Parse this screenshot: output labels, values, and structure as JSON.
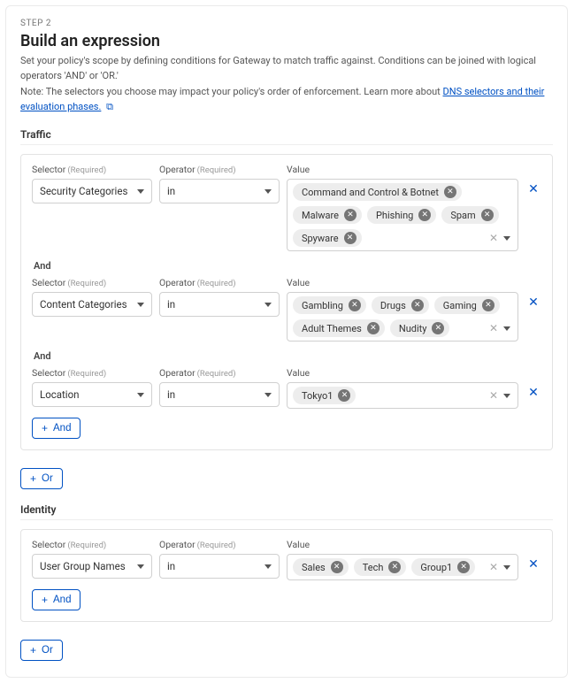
{
  "step_label": "STEP 2",
  "title": "Build an expression",
  "description_line1": "Set your policy's scope by defining conditions for Gateway to match traffic against. Conditions can be joined with logical operators 'AND' or 'OR.'",
  "description_line2_prefix": "Note: The selectors you choose may impact your policy's order of enforcement. Learn more about ",
  "description_link": "DNS selectors and their evaluation phases.",
  "labels": {
    "selector": "Selector",
    "operator": "Operator",
    "value": "Value",
    "required": "(Required)",
    "and": "And",
    "or": "Or",
    "add_and": "And",
    "add_or": "Or"
  },
  "sections": {
    "traffic": {
      "heading": "Traffic"
    },
    "identity": {
      "heading": "Identity"
    }
  },
  "traffic_rows": [
    {
      "selector": "Security Categories",
      "operator": "in",
      "values": [
        "Command and Control & Botnet",
        "Malware",
        "Phishing",
        "Spam",
        "Spyware"
      ]
    },
    {
      "selector": "Content Categories",
      "operator": "in",
      "values": [
        "Gambling",
        "Drugs",
        "Gaming",
        "Adult Themes",
        "Nudity"
      ]
    },
    {
      "selector": "Location",
      "operator": "in",
      "values": [
        "Tokyo1"
      ]
    }
  ],
  "identity_rows": [
    {
      "selector": "User Group Names",
      "operator": "in",
      "values": [
        "Sales",
        "Tech",
        "Group1"
      ]
    }
  ]
}
